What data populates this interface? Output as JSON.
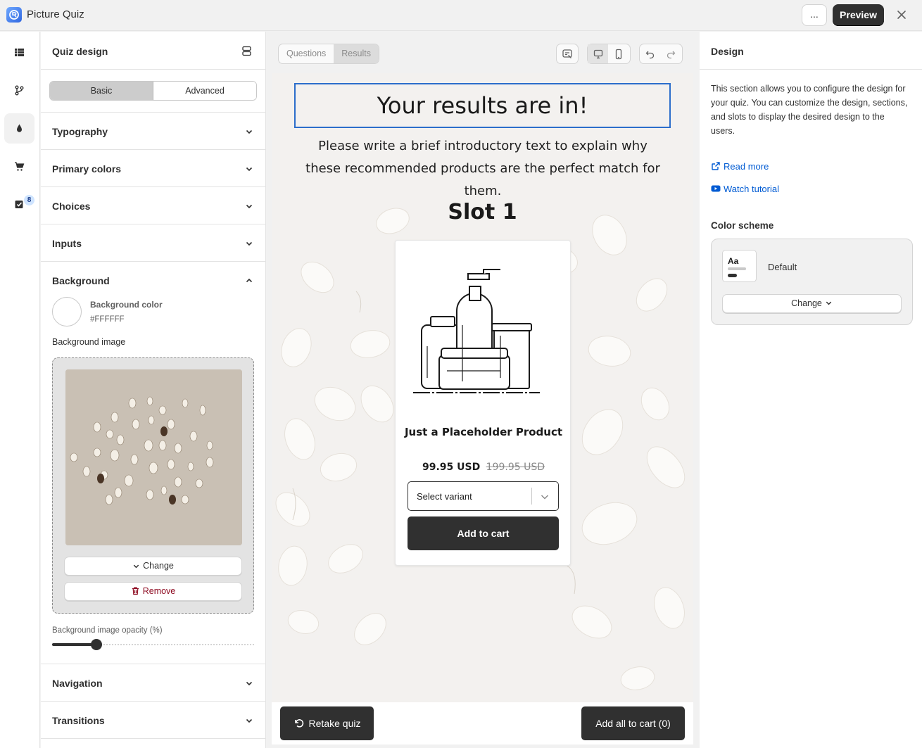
{
  "app": {
    "title": "Picture Quiz"
  },
  "topbar": {
    "more_label": "...",
    "preview_label": "Preview"
  },
  "rail": {
    "badge_count": "8"
  },
  "settings": {
    "title": "Quiz design",
    "mode_tabs": [
      "Basic",
      "Advanced"
    ],
    "active_mode": "Basic",
    "sections": {
      "typography": "Typography",
      "primary_colors": "Primary colors",
      "choices": "Choices",
      "inputs": "Inputs",
      "background": "Background",
      "navigation": "Navigation",
      "transitions": "Transitions"
    },
    "background": {
      "color_label": "Background color",
      "color_value": "#FFFFFF",
      "image_label": "Background image",
      "change_label": "Change",
      "remove_label": "Remove",
      "opacity_label": "Background image opacity (%)",
      "opacity_value": 0.22
    }
  },
  "canvas": {
    "tabs": [
      "Questions",
      "Results"
    ],
    "active_tab": "Results",
    "results_title": "Your results are in!",
    "intro_text": "Please write a brief introductory text to explain why these recommended products are the perfect match for them.",
    "slot_title": "Slot 1",
    "product": {
      "name": "Just a Placeholder Product",
      "price": "99.95 USD",
      "compare_price": "199.95 USD",
      "variant_placeholder": "Select variant",
      "add_to_cart_label": "Add to cart"
    },
    "footer": {
      "retake_label": "Retake quiz",
      "add_all_label": "Add all to cart (0)"
    }
  },
  "right_panel": {
    "title": "Design",
    "description": "This section allows you to configure the design for your quiz. You can customize the design, sections, and slots to display the desired design to the users.",
    "read_more_label": "Read more",
    "watch_tutorial_label": "Watch tutorial",
    "color_scheme_label": "Color scheme",
    "scheme_sample": "Aa",
    "scheme_name": "Default",
    "change_label": "Change"
  },
  "colors": {
    "accent_dark": "#303030",
    "link": "#005bd3",
    "focus": "#2c6ecb",
    "critical": "#8e0b21"
  }
}
